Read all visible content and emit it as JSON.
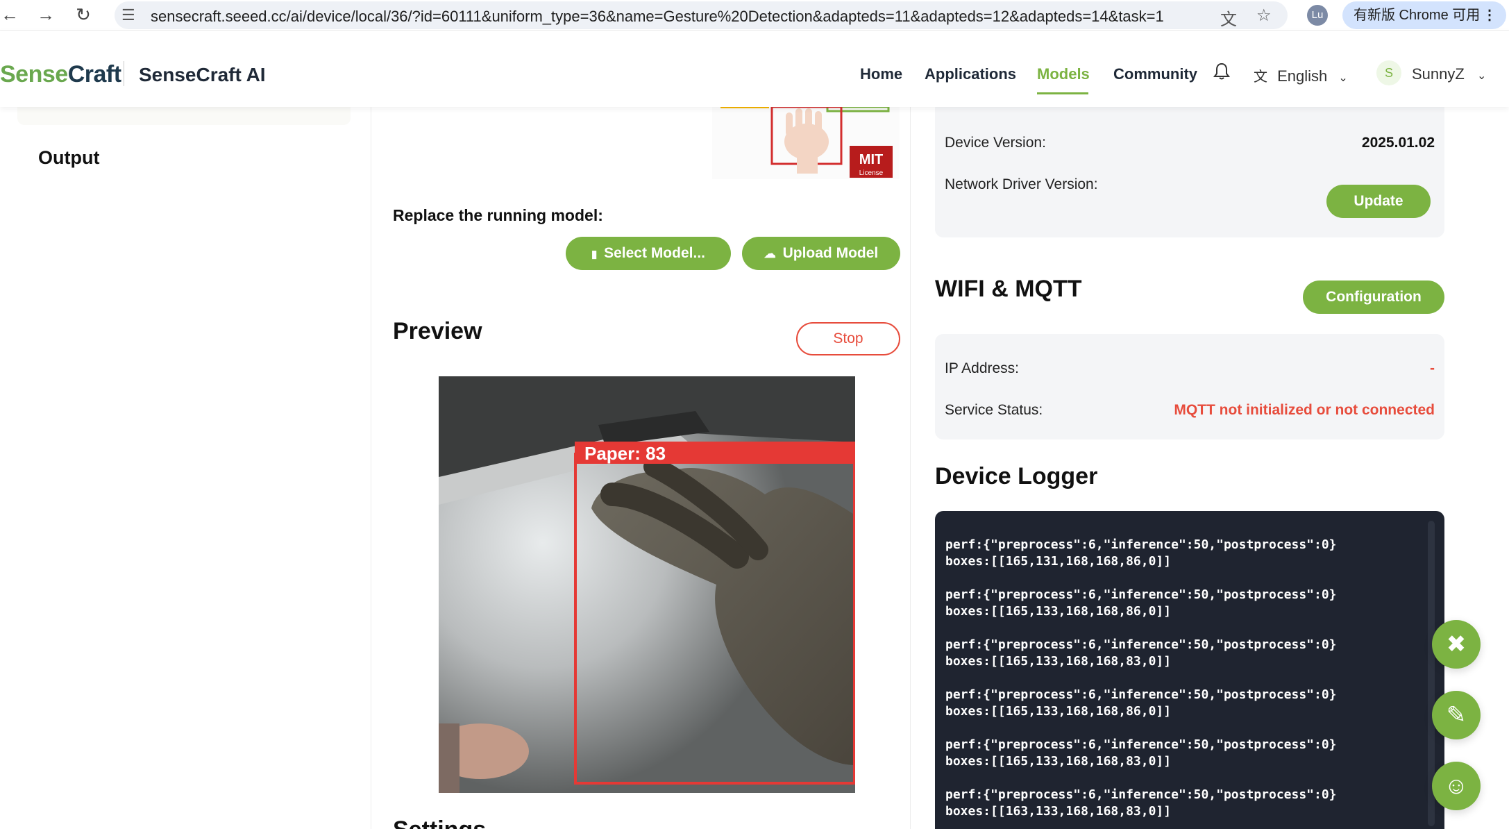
{
  "browser": {
    "url": "sensecraft.seeed.cc/ai/device/local/36/?id=60111&uniform_type=36&name=Gesture%20Detection&adapteds=11&adapteds=12&adapteds=14&task=1",
    "profile_initials": "Lu",
    "update_pill": "有新版 Chrome 可用"
  },
  "header": {
    "logo_sense": "Sense",
    "logo_craft": "Craft",
    "site_title": "SenseCraft AI",
    "menu": [
      "Home",
      "Applications",
      "Models",
      "Community"
    ],
    "active_menu": "Models",
    "language": "English",
    "avatar_initial": "S",
    "username": "SunnyZ"
  },
  "sidebar": {
    "output_label": "Output"
  },
  "main": {
    "replace_label": "Replace the running model:",
    "select_model_label": "Select Model...",
    "upload_model_label": "Upload Model",
    "preview_title": "Preview",
    "stop_label": "Stop",
    "detection_label": "Paper: 83",
    "thumb_badge": "License",
    "settings_title": "Settings"
  },
  "device": {
    "device_version_label": "Device Version:",
    "device_version_value": "2025.01.02",
    "network_driver_label": "Network Driver Version:",
    "update_label": "Update"
  },
  "wifi": {
    "title": "WIFI & MQTT",
    "config_label": "Configuration",
    "ip_label": "IP Address:",
    "ip_value": "-",
    "status_label": "Service Status:",
    "status_value": "MQTT not initialized or not connected"
  },
  "logger": {
    "title": "Device Logger",
    "entries": [
      {
        "perf": "perf:{\"preprocess\":6,\"inference\":50,\"postprocess\":0}",
        "boxes": "boxes:[[165,131,168,168,86,0]]"
      },
      {
        "perf": "perf:{\"preprocess\":6,\"inference\":50,\"postprocess\":0}",
        "boxes": "boxes:[[165,133,168,168,86,0]]"
      },
      {
        "perf": "perf:{\"preprocess\":6,\"inference\":50,\"postprocess\":0}",
        "boxes": "boxes:[[165,133,168,168,83,0]]"
      },
      {
        "perf": "perf:{\"preprocess\":6,\"inference\":50,\"postprocess\":0}",
        "boxes": "boxes:[[165,133,168,168,86,0]]"
      },
      {
        "perf": "perf:{\"preprocess\":6,\"inference\":50,\"postprocess\":0}",
        "boxes": "boxes:[[165,133,168,168,83,0]]"
      },
      {
        "perf": "perf:{\"preprocess\":6,\"inference\":50,\"postprocess\":0}",
        "boxes": "boxes:[[163,133,168,168,83,0]]"
      }
    ]
  },
  "colors": {
    "accent": "#7cb342",
    "error": "#e74c3c",
    "logger_bg": "#1f2430"
  },
  "icons": [
    "back-arrow-icon",
    "forward-arrow-icon",
    "reload-icon",
    "site-settings-icon",
    "translate-icon",
    "star-icon",
    "bell-icon",
    "translate-language-icon",
    "chevron-down-icon",
    "chip-icon",
    "cloud-upload-icon",
    "tools-icon",
    "feedback-icon",
    "community-icon"
  ]
}
